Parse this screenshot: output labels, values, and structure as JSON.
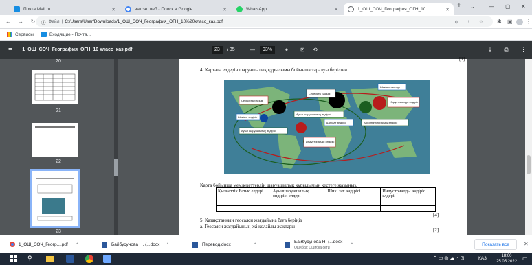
{
  "tabs": [
    {
      "title": "Почта Mail.ru",
      "fav": "#168de2"
    },
    {
      "title": "ватсап веб - Поиск в Google",
      "fav": "#4285f4"
    },
    {
      "title": "WhatsApp",
      "fav": "#25d366"
    },
    {
      "title": "1_ОШ_СОЧ_География_ОГН_10",
      "fav": "#5f6368"
    }
  ],
  "window": {
    "new_tab": "+",
    "chevron": "⌄",
    "min": "—",
    "max": "▢",
    "close": "✕"
  },
  "address": {
    "url": "C:/Users/User/Downloads/1_ОШ_СОЧ_География_ОГН_10%20класс_каз.pdf",
    "prefix": "Файл"
  },
  "bookmarks": {
    "apps": "Сервисы",
    "inbox": "Входящие - Почта..."
  },
  "pdf": {
    "title": "1_ОШ_СОЧ_География_ОГН_10 класс_каз.pdf",
    "page": "23",
    "total": "/ 35",
    "zoom": "93%",
    "minus": "—",
    "plus": "+"
  },
  "thumbs": {
    "p20": "20",
    "p21": "21",
    "p22": "22",
    "p23": "23"
  },
  "doc": {
    "q4": "4. Картада елдерін шаруашылық құрылымы бойынша таралуы берілген.",
    "map_labels": [
      "Сервистік басым",
      "Сервистік басым",
      "Шикізат экспорт",
      "Индустриялды өндіріс",
      "Ауыл шаруашылық өндірісі",
      "Шикізат өндіріс",
      "Шикізат өндіріс",
      "Агроиндустриалды өндіріс",
      "Ауыл шаруашылық өндірісі",
      "Индустриалды өндіріс"
    ],
    "table_caption": "Карта бойынша мемлекеттердің шаруашылық құрылымын кестеге жазыныз.",
    "table_headers": [
      "Қызметтік Батыс елдері",
      "Ауылшаруашылық өндірісі елдері",
      "Шикі зат өндірісі",
      "Индустриалды өндіріс елдері"
    ],
    "mark4": "[4]",
    "q5": "5. Қазақстанның геосаяси жағдайына баға беріңіз",
    "q5a_pre": "a. Геосаяси жағдайының ",
    "q5a_u": "екі",
    "q5a_post": " қолайлы жақтары",
    "mark2": "[2]",
    "mark_top": "[1]"
  },
  "downloads": {
    "items": [
      {
        "name": "1_ОШ_СОЧ_Геогр....pdf",
        "sub": ""
      },
      {
        "name": "Байбусунова Н. (...docx",
        "sub": ""
      },
      {
        "name": "Перевод.docx",
        "sub": ""
      },
      {
        "name": "Байбусунова Н. (...docx",
        "sub": "Ошибка: Ошибка сети"
      }
    ],
    "show_all": "Показать все"
  },
  "taskbar": {
    "lang": "КАЗ",
    "time": "18:00",
    "date": "25.05.2022"
  },
  "colors": {
    "tabbar": "#dee1e6",
    "pdfbar": "#323639",
    "viewer": "#525659",
    "taskbar": "#1f2937",
    "accent": "#1a73e8"
  }
}
